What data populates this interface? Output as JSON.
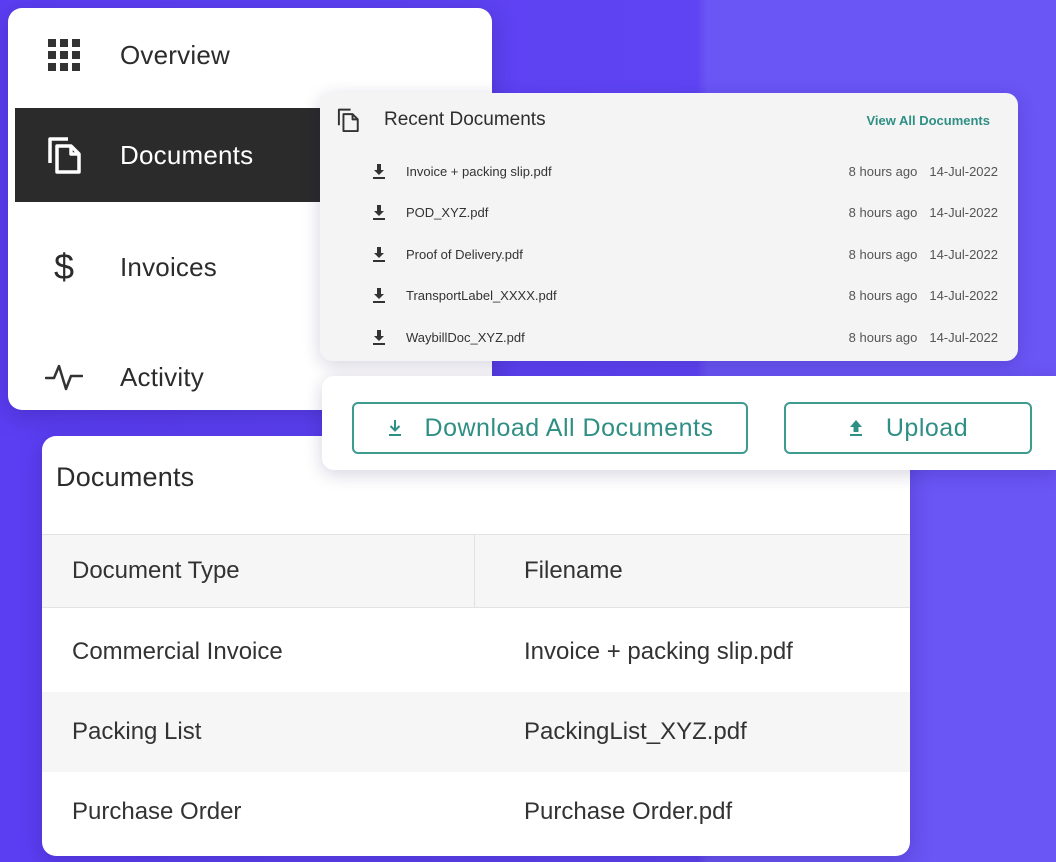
{
  "sidebar": {
    "items": [
      {
        "label": "Overview",
        "icon": "grid-icon",
        "active": false
      },
      {
        "label": "Documents",
        "icon": "documents-icon",
        "active": true
      },
      {
        "label": "Invoices",
        "icon": "dollar-icon",
        "icon_glyph": "$",
        "active": false
      },
      {
        "label": "Activity",
        "icon": "activity-icon",
        "active": false
      }
    ]
  },
  "recent": {
    "title": "Recent Documents",
    "view_all": "View All Documents",
    "items": [
      {
        "filename": "Invoice + packing slip.pdf",
        "ago": "8 hours ago",
        "date": "14-Jul-2022"
      },
      {
        "filename": "POD_XYZ.pdf",
        "ago": "8 hours ago",
        "date": "14-Jul-2022"
      },
      {
        "filename": "Proof of Delivery.pdf",
        "ago": "8 hours ago",
        "date": "14-Jul-2022"
      },
      {
        "filename": "TransportLabel_XXXX.pdf",
        "ago": "8 hours ago",
        "date": "14-Jul-2022"
      },
      {
        "filename": "WaybillDoc_XYZ.pdf",
        "ago": "8 hours ago",
        "date": "14-Jul-2022"
      }
    ]
  },
  "actions": {
    "download_all": "Download All Documents",
    "upload": "Upload"
  },
  "documents_table": {
    "title": "Documents",
    "columns": [
      "Document Type",
      "Filename"
    ],
    "rows": [
      [
        "Commercial Invoice",
        "Invoice + packing slip.pdf"
      ],
      [
        "Packing List",
        "PackingList_XYZ.pdf"
      ],
      [
        "Purchase Order",
        "Purchase Order.pdf"
      ]
    ]
  },
  "colors": {
    "accent": "#2f8f84",
    "background": "#5b3ef2",
    "active_nav": "#2b2b2b"
  }
}
